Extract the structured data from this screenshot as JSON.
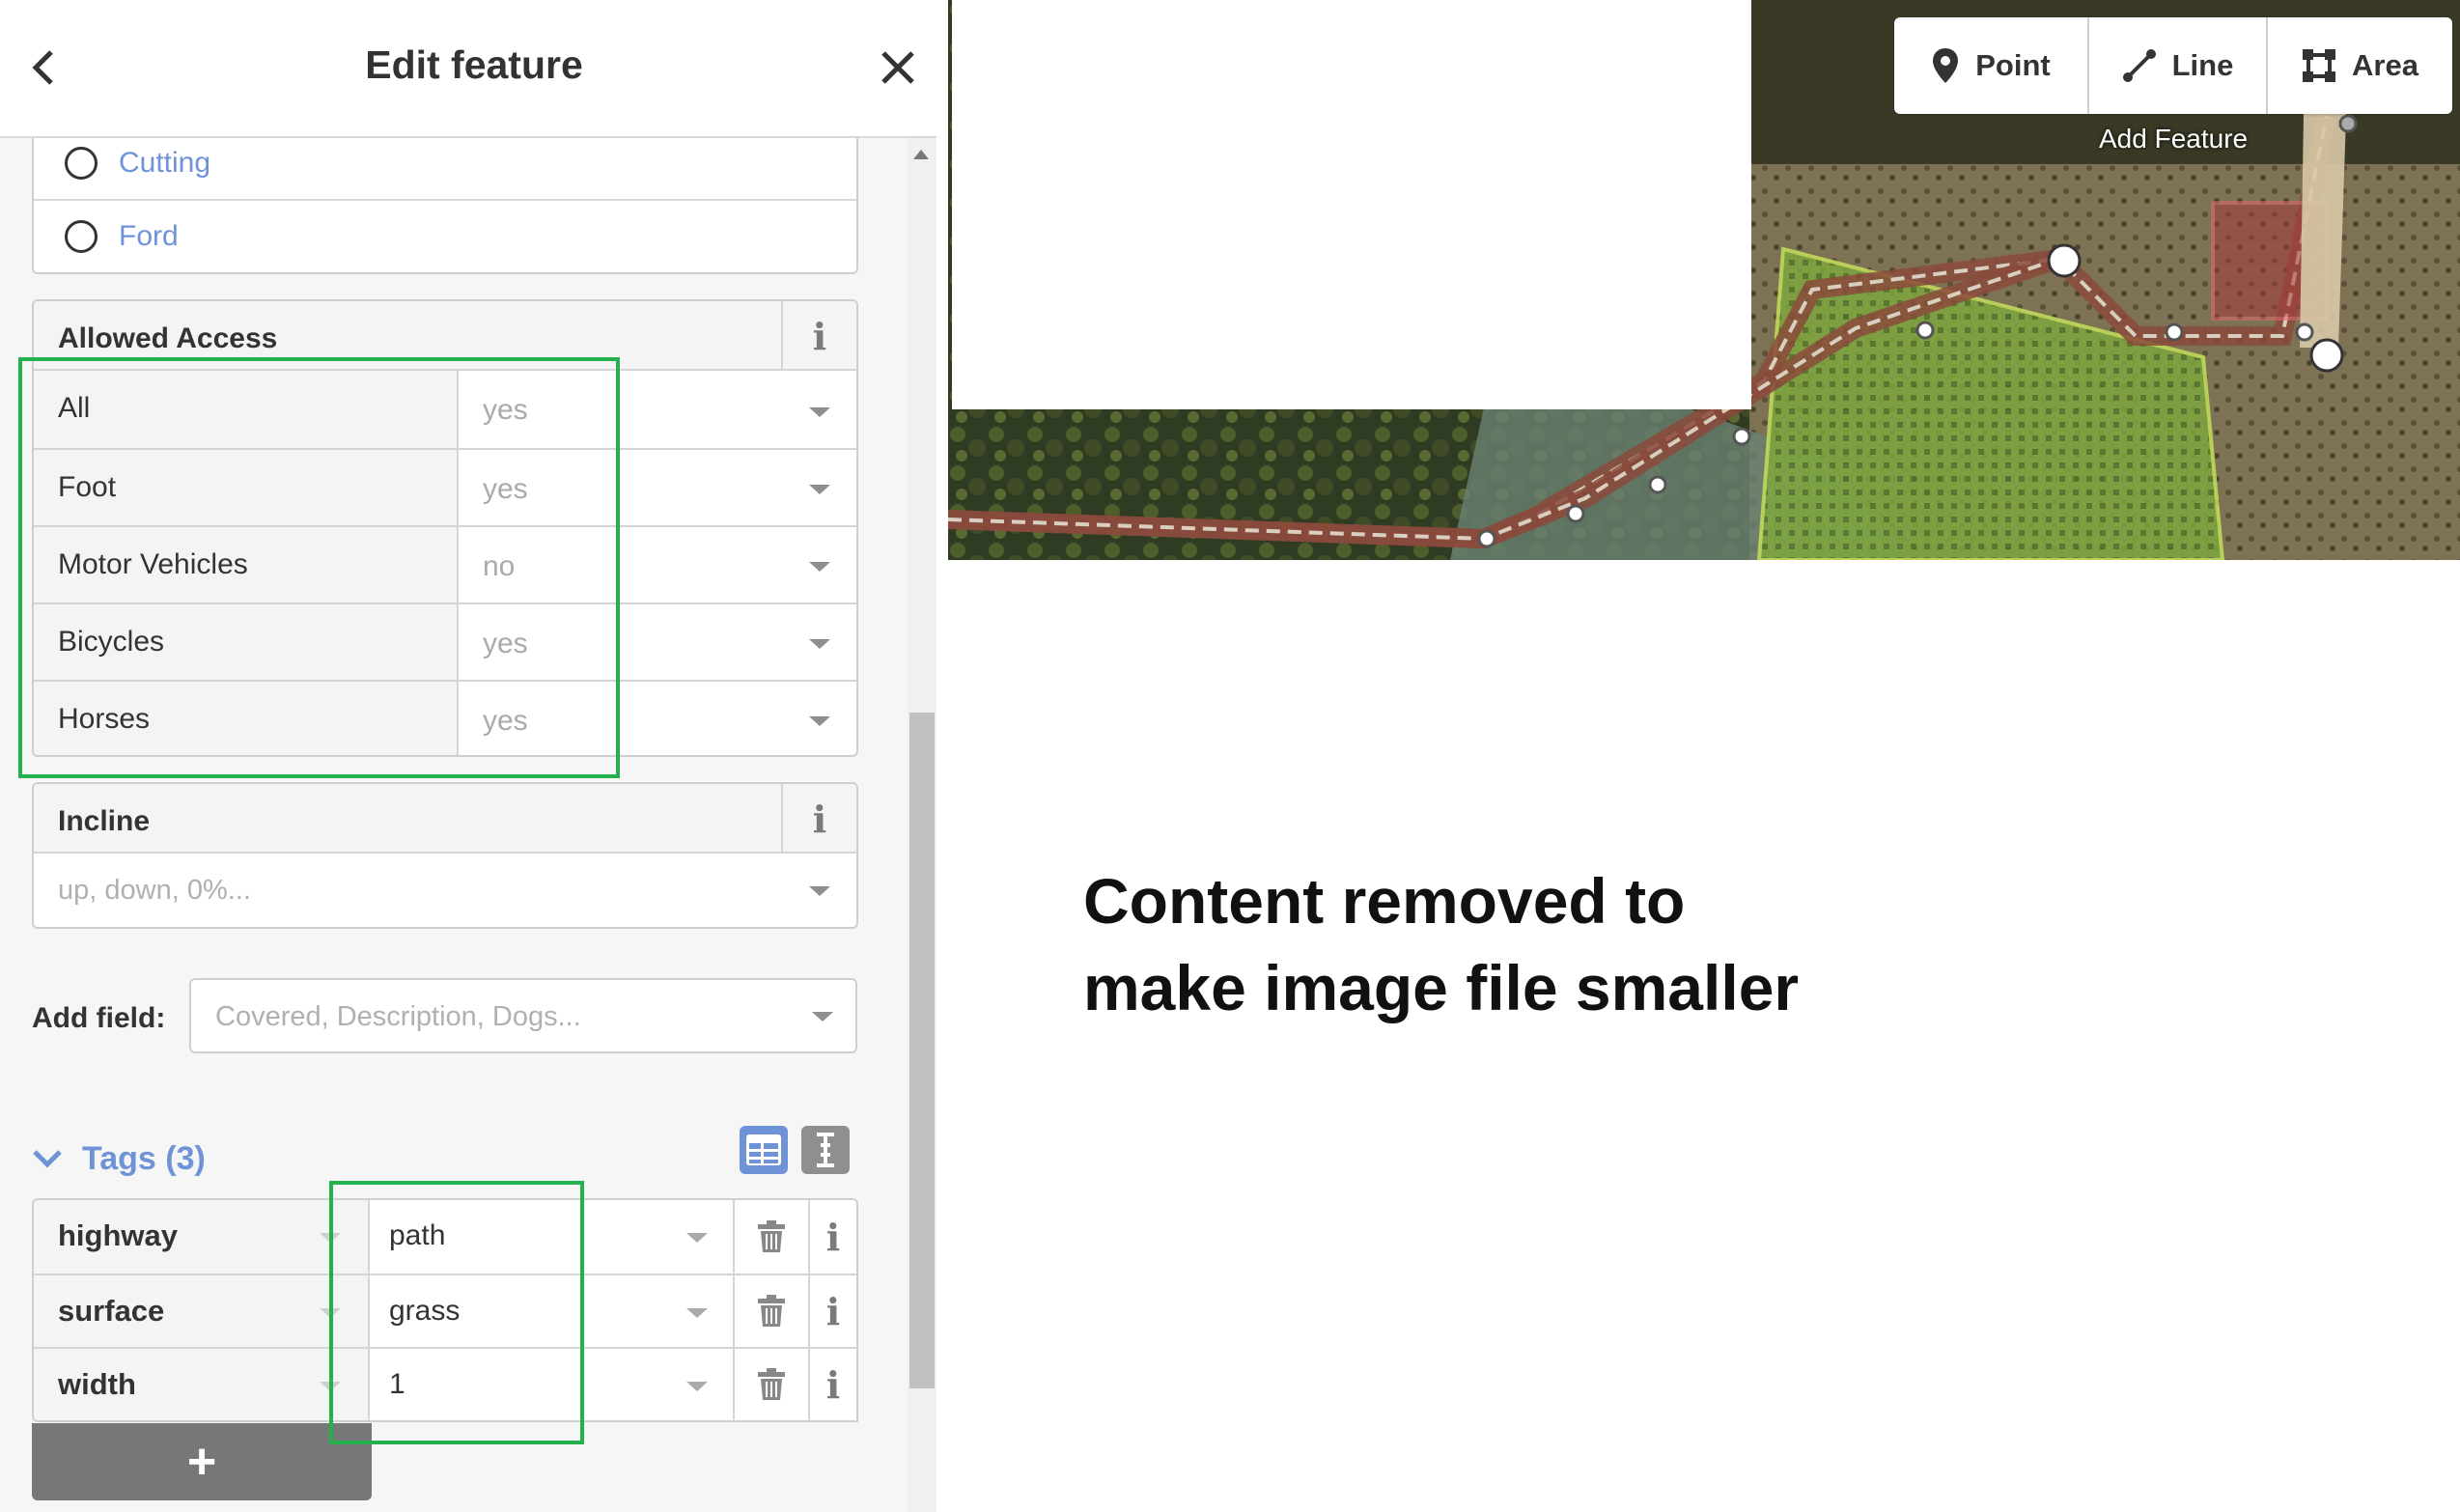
{
  "header": {
    "title": "Edit feature",
    "back_icon": "chevron-left-icon",
    "close_icon": "close-icon"
  },
  "structure_options": [
    "Cutting",
    "Ford"
  ],
  "allowed_access": {
    "label": "Allowed Access",
    "rows": [
      {
        "key": "All",
        "value": "yes"
      },
      {
        "key": "Foot",
        "value": "yes"
      },
      {
        "key": "Motor Vehicles",
        "value": "no"
      },
      {
        "key": "Bicycles",
        "value": "yes"
      },
      {
        "key": "Horses",
        "value": "yes"
      }
    ]
  },
  "incline": {
    "label": "Incline",
    "placeholder": "up, down, 0%..."
  },
  "add_field": {
    "label": "Add field:",
    "placeholder": "Covered, Description, Dogs..."
  },
  "tags": {
    "title": "Tags (3)",
    "rows": [
      {
        "key": "highway",
        "value": "path"
      },
      {
        "key": "surface",
        "value": "grass"
      },
      {
        "key": "width",
        "value": "1"
      }
    ],
    "add_label": "+"
  },
  "toolbar": {
    "point_label": "Point",
    "line_label": "Line",
    "area_label": "Area",
    "add_feature_label": "Add Feature"
  },
  "notice": {
    "line1": "Content removed to",
    "line2": "make image file smaller"
  },
  "colors": {
    "accent": "#6f93d7",
    "highlight": "#22b14c",
    "path": "#8a4a3c",
    "area": "#b6e05a"
  }
}
